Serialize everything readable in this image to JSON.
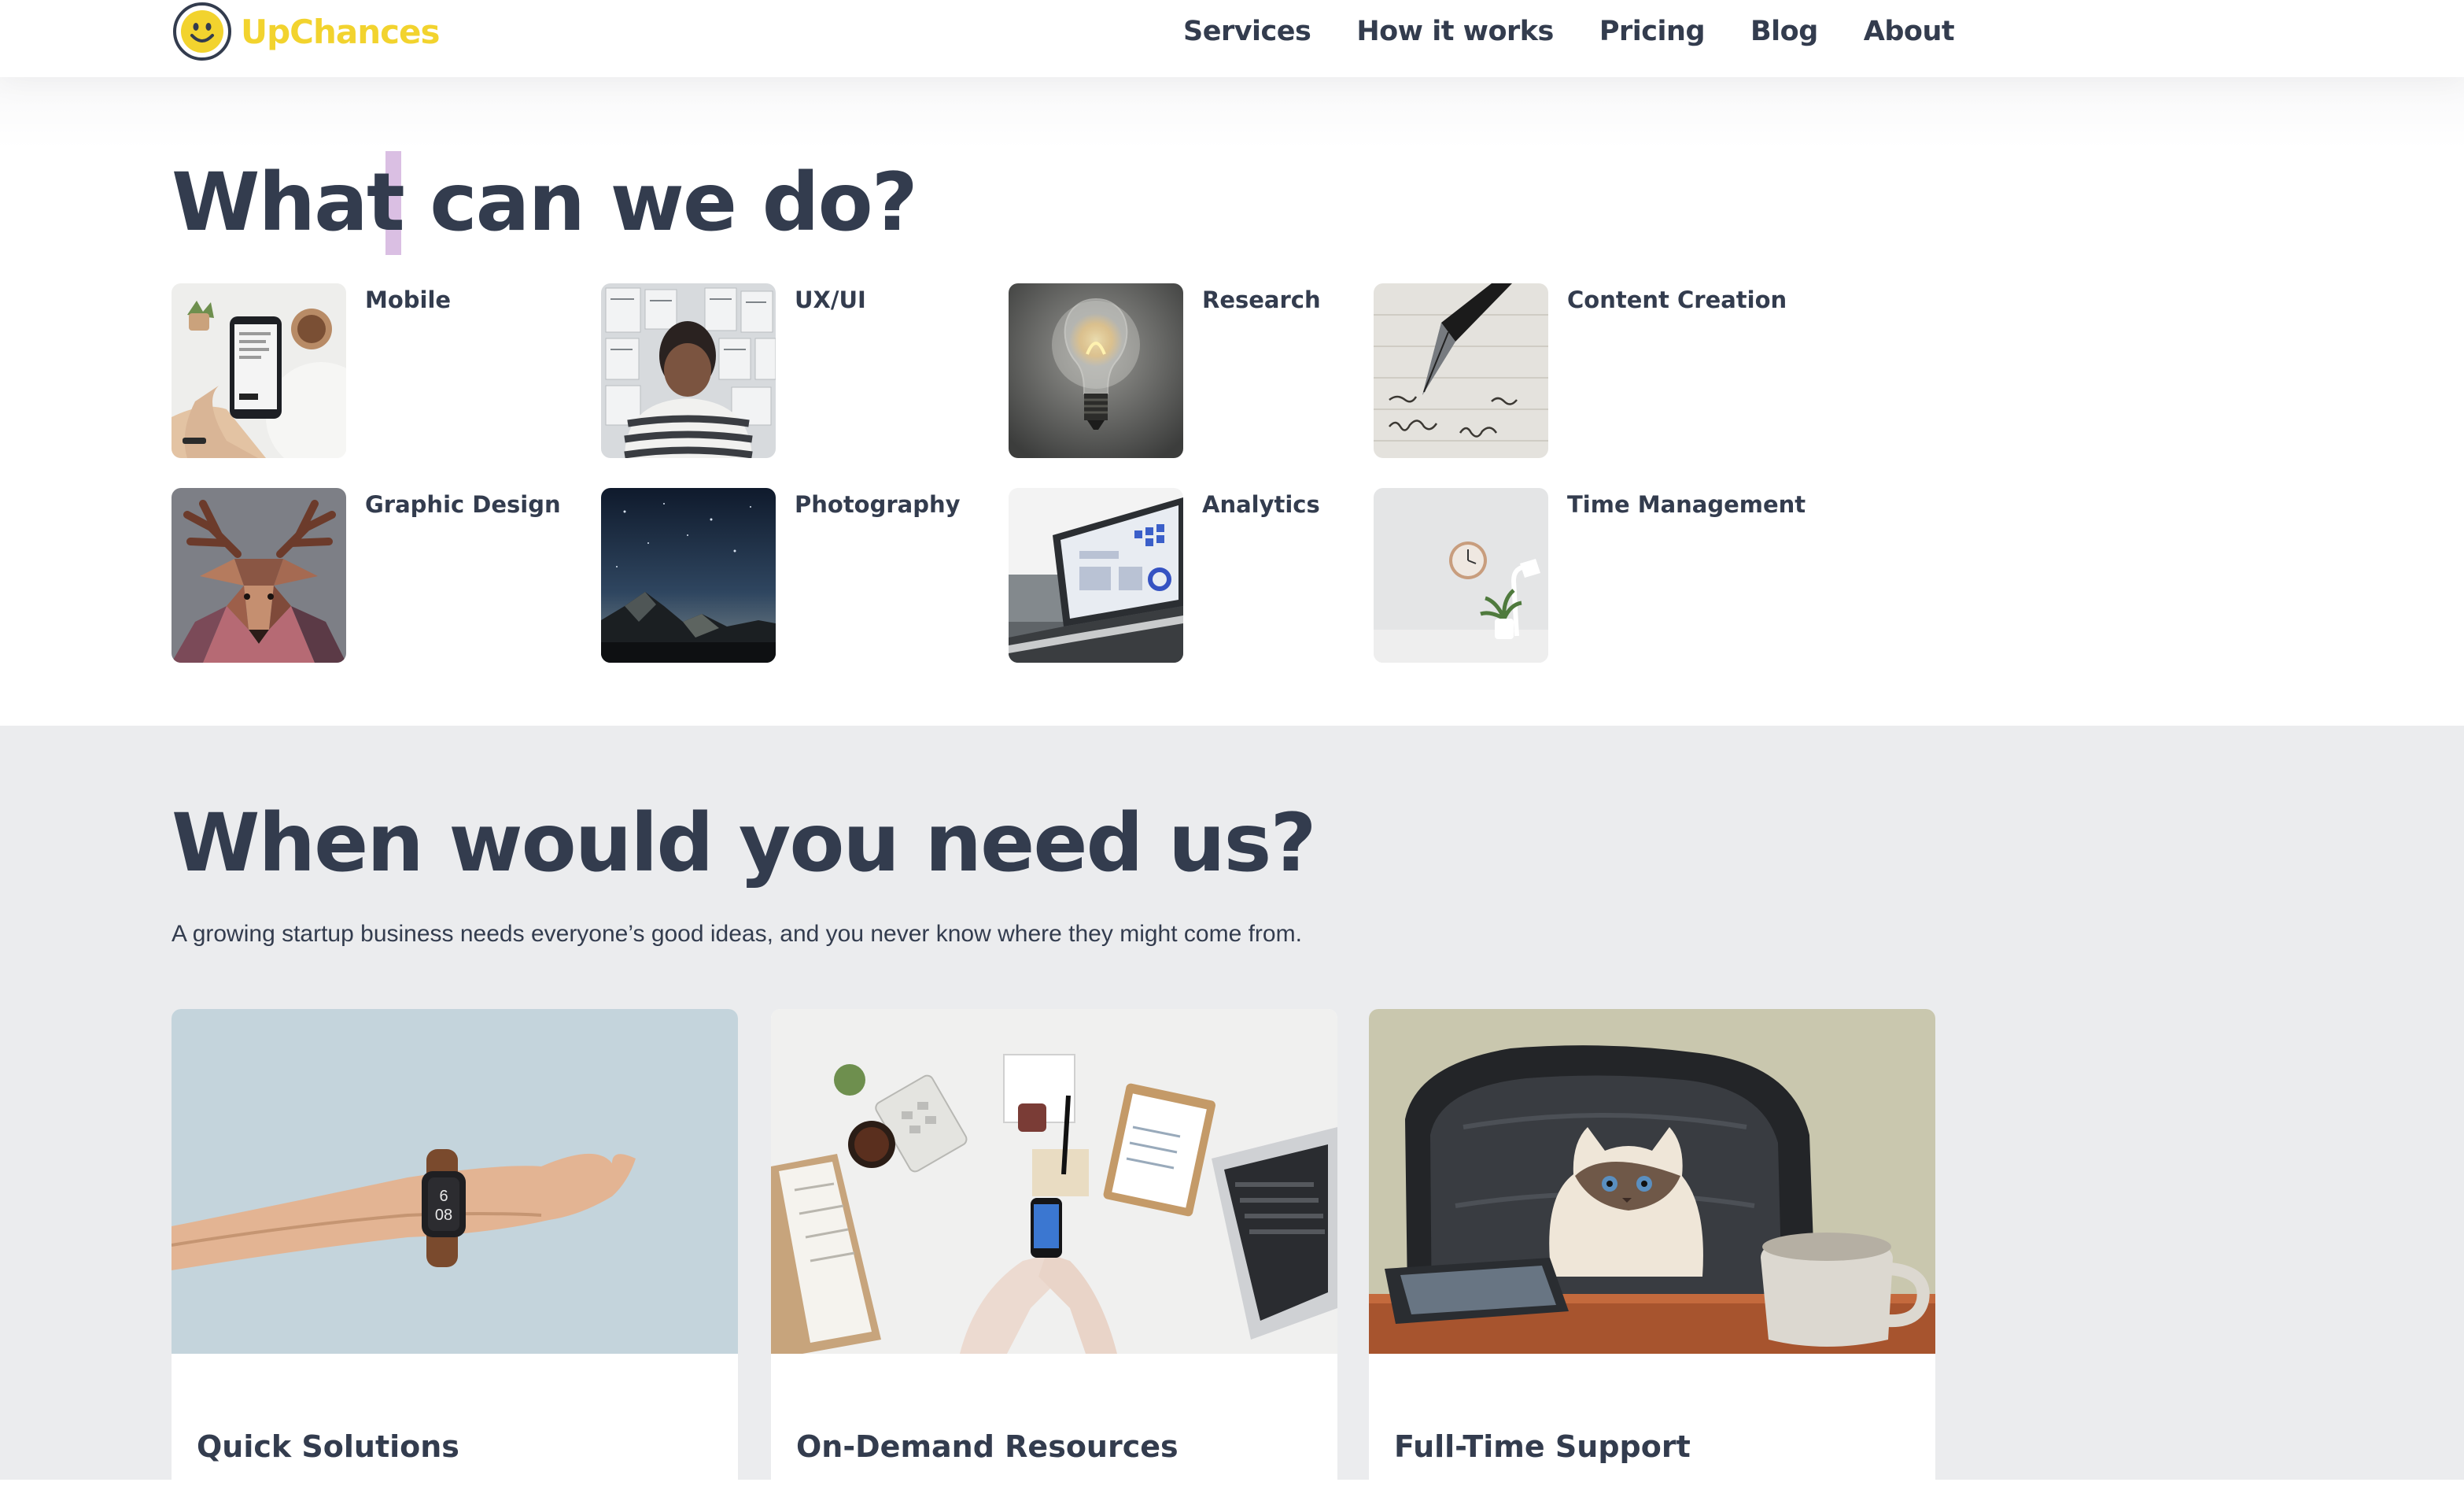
{
  "header": {
    "logo_text": "UpChances",
    "nav": [
      {
        "label": "Services"
      },
      {
        "label": "How it works"
      },
      {
        "label": "Pricing"
      },
      {
        "label": "Blog"
      },
      {
        "label": "About"
      }
    ]
  },
  "services": {
    "heading": "What can we do?",
    "items": [
      {
        "label": "Mobile",
        "icon": "phone-photo"
      },
      {
        "label": "UX/UI",
        "icon": "wireframe-wall-photo"
      },
      {
        "label": "Research",
        "icon": "lightbulb-photo"
      },
      {
        "label": "Content Creation",
        "icon": "fountain-pen-photo"
      },
      {
        "label": "Graphic Design",
        "icon": "low-poly-deer-photo"
      },
      {
        "label": "Photography",
        "icon": "night-sky-photo"
      },
      {
        "label": "Analytics",
        "icon": "laptop-dashboard-photo"
      },
      {
        "label": "Time Management",
        "icon": "wall-clock-photo"
      }
    ]
  },
  "needs": {
    "heading": "When would you need us?",
    "lead": "A growing startup business needs everyone’s good ideas, and you never know where they might come from.",
    "cards": [
      {
        "title": "Quick Solutions",
        "icon": "wristwatch-photo"
      },
      {
        "title": "On-Demand Resources",
        "icon": "desk-workspace-photo"
      },
      {
        "title": "Full-Time Support",
        "icon": "cat-in-office-chair-photo"
      }
    ]
  },
  "colors": {
    "brand": "#f2d32e",
    "text": "#333c4e",
    "section_bg": "#ebecee"
  }
}
